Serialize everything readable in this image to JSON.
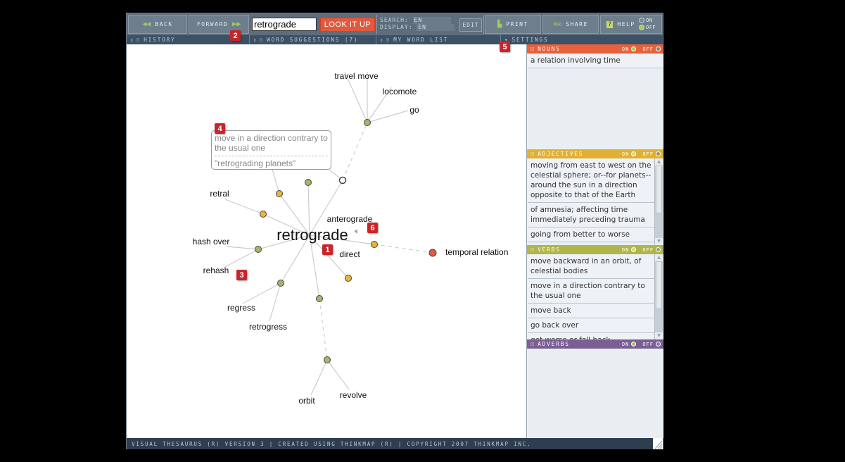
{
  "toolbar": {
    "back_label": "BACK",
    "forward_label": "FORWARD",
    "search_value": "retrograde",
    "lookup_label": "LOOK IT UP",
    "search_lang_label": "SEARCH:",
    "search_lang_value": "EN",
    "display_lang_label": "DISPLAY:",
    "display_lang_value": "EN",
    "edit_label": "EDIT",
    "print_label": "PRINT",
    "share_label": "SHARE",
    "help_label": "HELP",
    "help_on_label": "ON",
    "help_off_label": "OFF"
  },
  "subbar": {
    "history_label": "HISTORY",
    "suggestions_label": "WORD SUGGESTIONS (7)",
    "wordlist_label": "MY WORD LIST",
    "settings_label": "SETTINGS"
  },
  "graph": {
    "center_word": "retrograde",
    "words": [
      "travel",
      "move",
      "locomote",
      "go",
      "retral",
      "hash over",
      "rehash",
      "regress",
      "retrogress",
      "anterograde",
      "direct",
      "temporal relation",
      "orbit",
      "revolve"
    ],
    "tooltip": {
      "definition": "move in a direction contrary to the usual one",
      "example": "\"retrograding planets\""
    },
    "colors": {
      "verb": "#a8b46a",
      "adjective": "#e8b43c",
      "noun": "#e05a3d",
      "link": "#cccccc"
    }
  },
  "badges": [
    "1",
    "2",
    "3",
    "4",
    "5",
    "6"
  ],
  "panel": {
    "nouns": {
      "title": "NOUNS",
      "color": "#e8613c",
      "on_label": "ON",
      "off_label": "OFF",
      "definitions": [
        "a relation involving time"
      ]
    },
    "adjectives": {
      "title": "ADJECTIVES",
      "color": "#e0b035",
      "on_label": "ON",
      "off_label": "OFF",
      "definitions": [
        "moving from east to west on the celestial sphere; or--for planets--around the sun in a direction opposite to that of the Earth",
        "of amnesia; affecting time immediately preceding trauma",
        "going from better to worse"
      ]
    },
    "verbs": {
      "title": "VERBS",
      "color": "#b0b54a",
      "on_label": "ON",
      "off_label": "OFF",
      "definitions": [
        "move backward in an orbit, of celestial bodies",
        "move in a direction contrary to the usual one",
        "move back",
        "go back over",
        "get worse or fall back"
      ]
    },
    "adverbs": {
      "title": "ADVERBS",
      "color": "#7b5e94",
      "on_label": "ON",
      "off_label": "OFF",
      "definitions": []
    }
  },
  "footer": {
    "text": "VISUAL THESAURUS (R) VERSION 3 | CREATED USING THINKMAP (R) | COPYRIGHT 2007 THINKMAP INC."
  }
}
